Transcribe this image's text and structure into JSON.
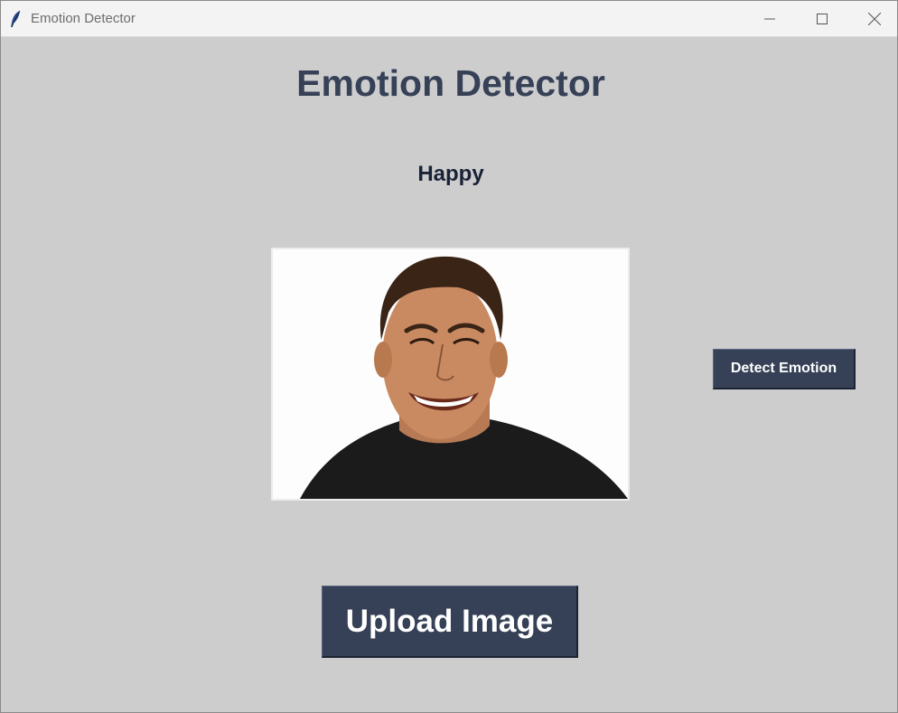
{
  "window": {
    "title": "Emotion Detector",
    "icon": "feather-icon",
    "controls": [
      "minimize-icon",
      "maximize-icon",
      "close-icon"
    ]
  },
  "main": {
    "heading": "Emotion Detector",
    "emotion_result": "Happy",
    "detect_button_label": "Detect Emotion",
    "upload_button_label": "Upload Image"
  },
  "colors": {
    "background": "#cdcdcd",
    "heading": "#364157",
    "result": "#1a2238",
    "button": "#364157",
    "button_text": "#ffffff"
  }
}
